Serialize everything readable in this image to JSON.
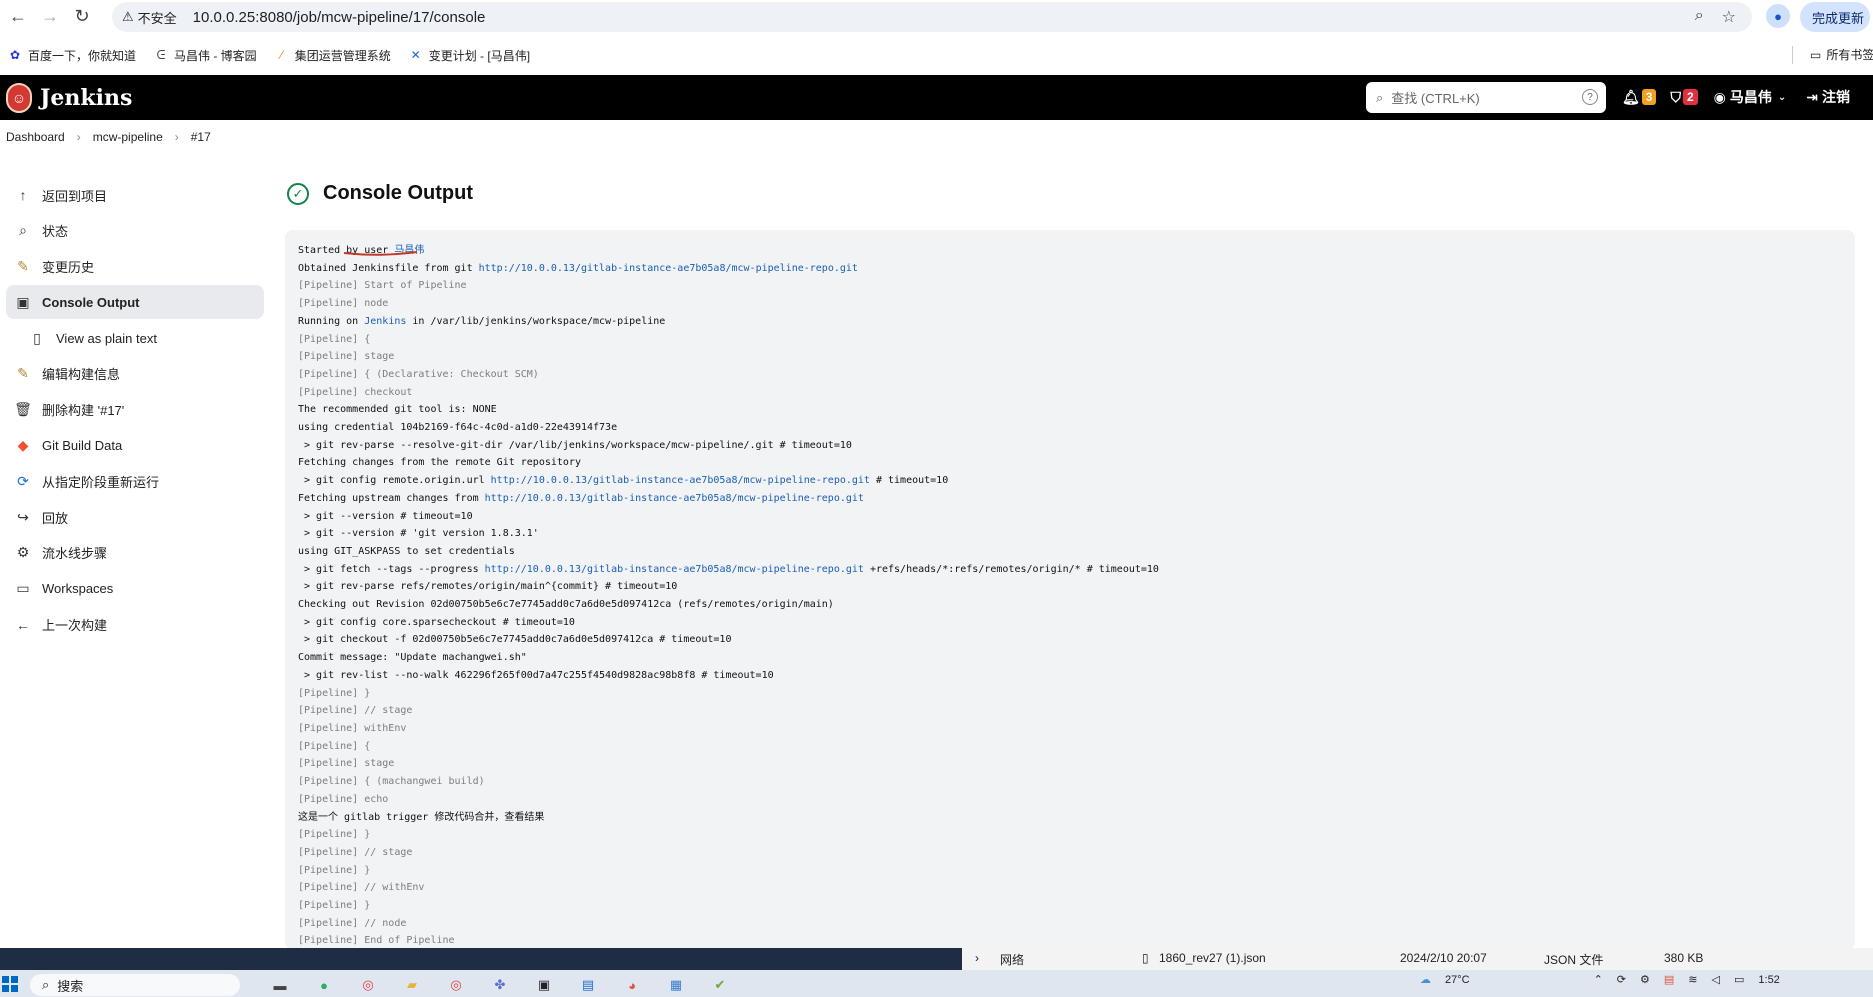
{
  "browser": {
    "security_label": "不安全",
    "url": "10.0.0.25:8080/job/mcw-pipeline/17/console",
    "update_label": "完成更新"
  },
  "bookmarks": {
    "items": [
      "百度一下，你就知道",
      "马昌伟 - 博客园",
      "集团运营管理系统",
      "变更计划 - [马昌伟]"
    ],
    "all_label": "所有书签"
  },
  "header": {
    "app_name": "Jenkins",
    "search_placeholder": "查找 (CTRL+K)",
    "notifications_count": "3",
    "security_count": "2",
    "user_name": "马昌伟",
    "logout_label": "注销"
  },
  "breadcrumb": [
    "Dashboard",
    "mcw-pipeline",
    "#17"
  ],
  "sidebar": {
    "items": [
      {
        "label": "返回到项目",
        "icon": "arrow-up-icon"
      },
      {
        "label": "状态",
        "icon": "search-icon"
      },
      {
        "label": "变更历史",
        "icon": "notepad-icon"
      },
      {
        "label": "Console Output",
        "icon": "terminal-icon"
      },
      {
        "label": "View as plain text",
        "icon": "document-icon"
      },
      {
        "label": "编辑构建信息",
        "icon": "notepad-icon"
      },
      {
        "label": "删除构建 '#17'",
        "icon": "trash-icon"
      },
      {
        "label": "Git Build Data",
        "icon": "git-icon"
      },
      {
        "label": "从指定阶段重新运行",
        "icon": "rerun-icon"
      },
      {
        "label": "回放",
        "icon": "replay-icon"
      },
      {
        "label": "流水线步骤",
        "icon": "gear-icon"
      },
      {
        "label": "Workspaces",
        "icon": "folder-icon"
      },
      {
        "label": "上一次构建",
        "icon": "arrow-left-icon"
      }
    ]
  },
  "main": {
    "title": "Console Output"
  },
  "console": {
    "lines": [
      [
        {
          "t": "Started by user "
        },
        {
          "t": "马昌伟",
          "c": "lk"
        }
      ],
      [
        {
          "t": "Obtained Jenkinsfile from git "
        },
        {
          "t": "http://10.0.0.13/gitlab-instance-ae7b05a8/mcw-pipeline-repo.git",
          "c": "lk"
        }
      ],
      [
        {
          "t": "[Pipeline] Start of Pipeline",
          "c": "pl"
        }
      ],
      [
        {
          "t": "[Pipeline] node",
          "c": "pl"
        }
      ],
      [
        {
          "t": "Running on "
        },
        {
          "t": "Jenkins",
          "c": "lk"
        },
        {
          "t": " in /var/lib/jenkins/workspace/mcw-pipeline"
        }
      ],
      [
        {
          "t": "[Pipeline] {",
          "c": "pl"
        }
      ],
      [
        {
          "t": "[Pipeline] stage",
          "c": "pl"
        }
      ],
      [
        {
          "t": "[Pipeline] { (Declarative: Checkout SCM)",
          "c": "pl"
        }
      ],
      [
        {
          "t": "[Pipeline] checkout",
          "c": "pl"
        }
      ],
      [
        {
          "t": "The recommended git tool is: NONE"
        }
      ],
      [
        {
          "t": "using credential 104b2169-f64c-4c0d-a1d0-22e43914f73e"
        }
      ],
      [
        {
          "t": " > git rev-parse --resolve-git-dir /var/lib/jenkins/workspace/mcw-pipeline/.git # timeout=10"
        }
      ],
      [
        {
          "t": "Fetching changes from the remote Git repository"
        }
      ],
      [
        {
          "t": " > git config remote.origin.url "
        },
        {
          "t": "http://10.0.0.13/gitlab-instance-ae7b05a8/mcw-pipeline-repo.git",
          "c": "lk"
        },
        {
          "t": " # timeout=10"
        }
      ],
      [
        {
          "t": "Fetching upstream changes from "
        },
        {
          "t": "http://10.0.0.13/gitlab-instance-ae7b05a8/mcw-pipeline-repo.git",
          "c": "lk"
        }
      ],
      [
        {
          "t": " > git --version # timeout=10"
        }
      ],
      [
        {
          "t": " > git --version # 'git version 1.8.3.1'"
        }
      ],
      [
        {
          "t": "using GIT_ASKPASS to set credentials"
        }
      ],
      [
        {
          "t": " > git fetch --tags --progress "
        },
        {
          "t": "http://10.0.0.13/gitlab-instance-ae7b05a8/mcw-pipeline-repo.git",
          "c": "lk"
        },
        {
          "t": " +refs/heads/*:refs/remotes/origin/* # timeout=10"
        }
      ],
      [
        {
          "t": " > git rev-parse refs/remotes/origin/main^{commit} # timeout=10"
        }
      ],
      [
        {
          "t": "Checking out Revision 02d00750b5e6c7e7745add0c7a6d0e5d097412ca (refs/remotes/origin/main)"
        }
      ],
      [
        {
          "t": " > git config core.sparsecheckout # timeout=10"
        }
      ],
      [
        {
          "t": " > git checkout -f 02d00750b5e6c7e7745add0c7a6d0e5d097412ca # timeout=10"
        }
      ],
      [
        {
          "t": "Commit message: \"Update machangwei.sh\""
        }
      ],
      [
        {
          "t": " > git rev-list --no-walk 462296f265f00d7a47c255f4540d9828ac98b8f8 # timeout=10"
        }
      ],
      [
        {
          "t": "[Pipeline] }",
          "c": "pl"
        }
      ],
      [
        {
          "t": "[Pipeline] // stage",
          "c": "pl"
        }
      ],
      [
        {
          "t": "[Pipeline] withEnv",
          "c": "pl"
        }
      ],
      [
        {
          "t": "[Pipeline] {",
          "c": "pl"
        }
      ],
      [
        {
          "t": "[Pipeline] stage",
          "c": "pl"
        }
      ],
      [
        {
          "t": "[Pipeline] { (machangwei build)",
          "c": "pl"
        }
      ],
      [
        {
          "t": "[Pipeline] echo",
          "c": "pl"
        }
      ],
      [
        {
          "t": "这是一个 gitlab trigger 修改代码合并，查看结果"
        }
      ],
      [
        {
          "t": "[Pipeline] }",
          "c": "pl"
        }
      ],
      [
        {
          "t": "[Pipeline] // stage",
          "c": "pl"
        }
      ],
      [
        {
          "t": "[Pipeline] }",
          "c": "pl"
        }
      ],
      [
        {
          "t": "[Pipeline] // withEnv",
          "c": "pl"
        }
      ],
      [
        {
          "t": "[Pipeline] }",
          "c": "pl"
        }
      ],
      [
        {
          "t": "[Pipeline] // node",
          "c": "pl"
        }
      ],
      [
        {
          "t": "[Pipeline] End of Pipeline",
          "c": "pl"
        }
      ]
    ]
  },
  "explorer_row": {
    "folder": "网络",
    "file_name": "1860_rev27 (1).json",
    "modified": "2024/2/10 20:07",
    "type": "JSON 文件",
    "size": "380 KB"
  },
  "taskbar": {
    "search_label": "搜索",
    "temperature": "27°C",
    "time": "1:52"
  },
  "colors": {
    "header_bg": "#000000",
    "success": "#138347",
    "link": "#1a5fb4",
    "console_bg": "#f2f3f5"
  }
}
